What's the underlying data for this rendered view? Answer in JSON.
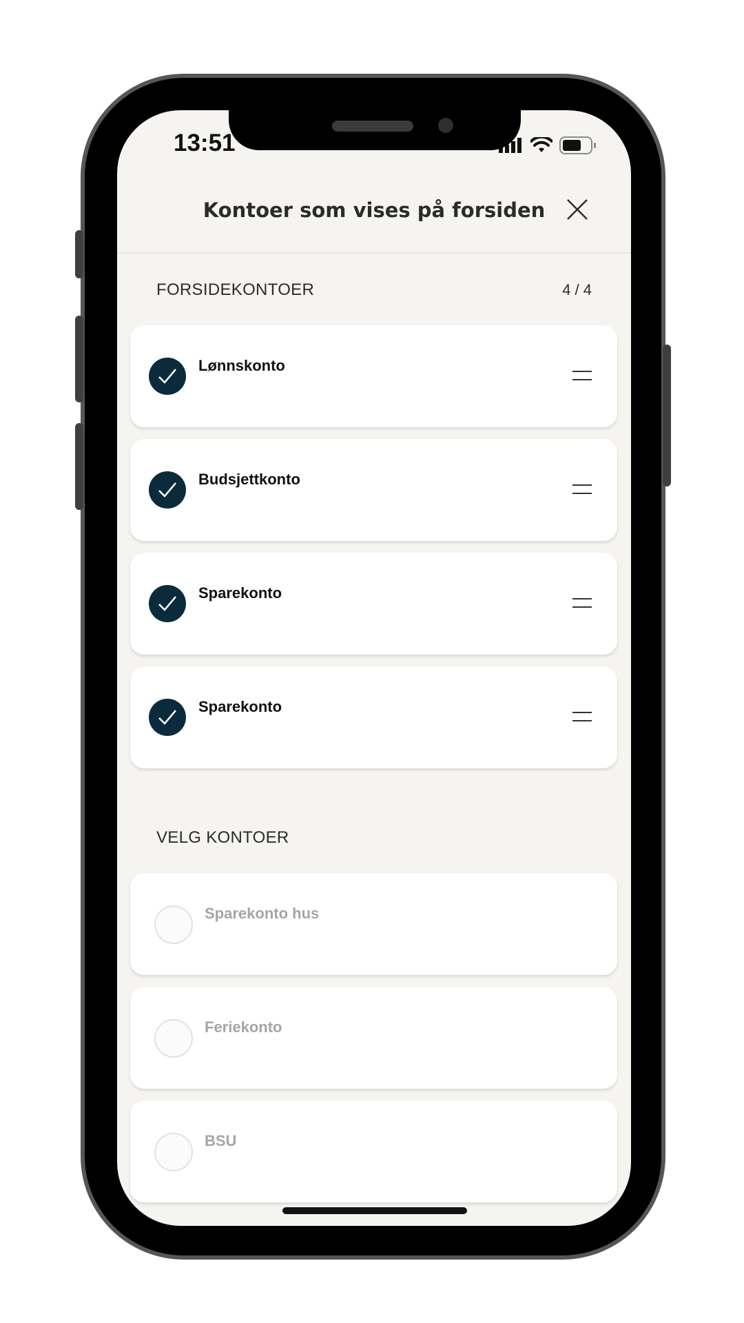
{
  "status_bar": {
    "time": "13:51",
    "icons": [
      "signal-icon",
      "wifi-icon",
      "battery-icon"
    ]
  },
  "header": {
    "title": "Kontoer som vises på forsiden",
    "close_icon": "close-icon"
  },
  "front_accounts": {
    "label": "FORSIDEKONTOER",
    "count": "4 / 4",
    "items": [
      {
        "name": "Lønnskonto",
        "selected": true
      },
      {
        "name": "Budsjettkonto",
        "selected": true
      },
      {
        "name": "Sparekonto",
        "selected": true
      },
      {
        "name": "Sparekonto",
        "selected": true
      }
    ]
  },
  "choose_accounts": {
    "label": "VELG KONTOER",
    "items": [
      {
        "name": "Sparekonto hus",
        "selected": false
      },
      {
        "name": "Feriekonto",
        "selected": false
      },
      {
        "name": "BSU",
        "selected": false
      }
    ]
  },
  "colors": {
    "screen_bg": "#f5f4f1",
    "check_fill": "#0b2b3d",
    "muted_text": "#a5a5a5"
  }
}
